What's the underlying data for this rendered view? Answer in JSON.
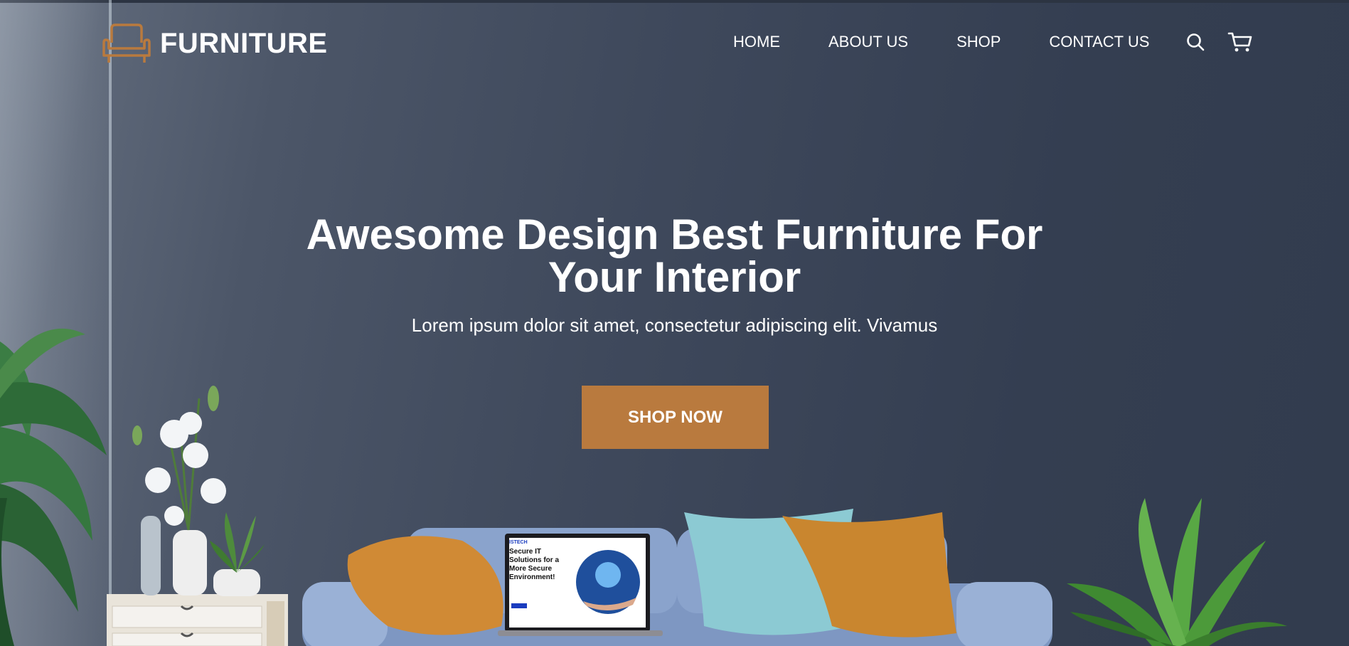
{
  "brand": {
    "name": "FURNITURE",
    "icon": "sofa-icon",
    "accent": "#b97a3e"
  },
  "nav": {
    "items": [
      {
        "label": "HOME"
      },
      {
        "label": "ABOUT US"
      },
      {
        "label": "SHOP"
      },
      {
        "label": "CONTACT US"
      }
    ],
    "search_icon": "search-icon",
    "cart_icon": "cart-icon"
  },
  "hero": {
    "title": "Awesome Design Best Furniture For Your Interior",
    "subtitle": "Lorem ipsum dolor sit amet, consectetur adipiscing elit. Vivamus",
    "cta_label": "SHOP NOW",
    "cta_color": "#b97a3e"
  },
  "laptop_screen": {
    "brand": "ISTECH",
    "headline": "Secure IT Solutions for a More Secure Environment!"
  }
}
